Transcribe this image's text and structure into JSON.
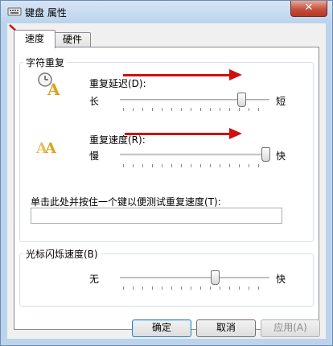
{
  "window": {
    "title": "键盘 属性",
    "close_glyph": "✕"
  },
  "tabs": [
    {
      "label": "速度",
      "selected": true
    },
    {
      "label": "硬件",
      "selected": false
    }
  ],
  "repeat_group": {
    "title": "字符重复",
    "delay": {
      "label": "重复延迟(D):",
      "min_label": "长",
      "max_label": "短",
      "level": 0.83
    },
    "rate": {
      "label": "重复速度(R):",
      "min_label": "慢",
      "max_label": "快",
      "level": 1.0
    },
    "test": {
      "label": "单击此处并按住一个键以便测试重复速度(T):",
      "value": ""
    }
  },
  "blink_group": {
    "title": "光标闪烁速度(B)",
    "min_label": "无",
    "max_label": "快",
    "level": 0.64
  },
  "buttons": {
    "ok": "确定",
    "cancel": "取消",
    "apply": "应用(A)"
  },
  "colors": {
    "annotation_arrow": "#d01010"
  }
}
